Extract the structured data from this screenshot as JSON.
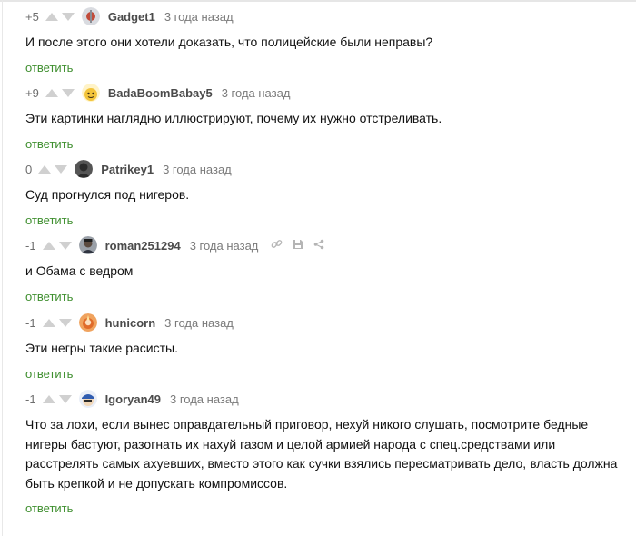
{
  "comments": [
    {
      "rating": "+5",
      "user": "Gadget1",
      "time": "3 года назад",
      "text": "И после этого они хотели доказать, что полицейские были неправы?",
      "reply": "ответить"
    },
    {
      "rating": "+9",
      "user": "BadaBoomBabay5",
      "time": "3 года назад",
      "text": "Эти картинки наглядно иллюстрируют, почему их нужно отстреливать.",
      "reply": "ответить"
    },
    {
      "rating": "0",
      "user": "Patrikey1",
      "time": "3 года назад",
      "text": "Суд прогнулся под нигеров.",
      "reply": "ответить"
    },
    {
      "rating": "-1",
      "user": "roman251294",
      "time": "3 года назад",
      "text": "и Обама с ведром",
      "reply": "ответить"
    },
    {
      "rating": "-1",
      "user": "hunicorn",
      "time": "3 года назад",
      "text": "Эти негры такие расисты.",
      "reply": "ответить"
    },
    {
      "rating": "-1",
      "user": "Igoryan49",
      "time": "3 года назад",
      "text": "Что за лохи, если вынес оправдательный приговор, нехуй никого слушать, посмотрите бедные нигеры бастуют, разогнать их нахуй газом и целой армией народа с спец.средствами или расстрелять самых ахуевших, вместо этого как сучки взялись пересматривать дело, власть должна быть крепкой и не допускать компромиссов.",
      "reply": "ответить"
    }
  ],
  "colors": {
    "reply": "#3f8f2f",
    "username": "#4b4b4b",
    "meta": "#7a7a7a",
    "arrow": "#d0d0d0"
  }
}
